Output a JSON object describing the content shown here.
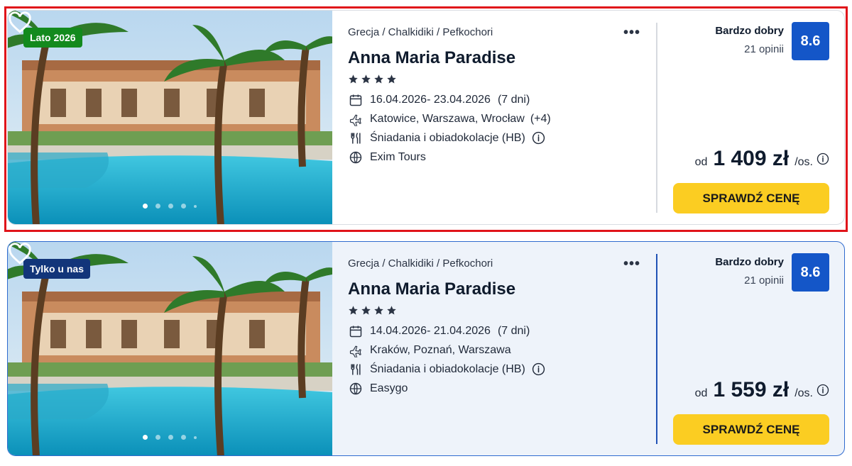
{
  "offers": [
    {
      "badge": "Lato 2026",
      "badge_color": "#138a1d",
      "breadcrumb": "Grecja / Chalkidiki / Pefkochori",
      "hotel_name": "Anna Maria Paradise",
      "stars": 4,
      "dates": "16.04.2026- 23.04.2026",
      "nights": "(7 dni)",
      "departures": "Katowice, Warszawa, Wrocław",
      "departures_extra": "(+4)",
      "board": "Śniadania i obiadokolacje (HB)",
      "operator": "Exim Tours",
      "rating_label": "Bardzo dobry",
      "rating_count": "21 opinii",
      "score": "8.6",
      "price_from": "od",
      "price": "1 409 zł",
      "price_unit": "/os.",
      "cta_label": "SPRAWDŹ CENĘ",
      "highlighted": true
    },
    {
      "badge": "Tylko u nas",
      "badge_color": "#12357a",
      "breadcrumb": "Grecja / Chalkidiki / Pefkochori",
      "hotel_name": "Anna Maria Paradise",
      "stars": 4,
      "dates": "14.04.2026- 21.04.2026",
      "nights": "(7 dni)",
      "departures": "Kraków, Poznań, Warszawa",
      "departures_extra": "",
      "board": "Śniadania i obiadokolacje (HB)",
      "operator": "Easygo",
      "rating_label": "Bardzo dobry",
      "rating_count": "21 opinii",
      "score": "8.6",
      "price_from": "od",
      "price": "1 559 zł",
      "price_unit": "/os.",
      "cta_label": "SPRAWDŹ CENĘ",
      "highlighted": false
    }
  ],
  "colors": {
    "cta": "#fbcd22",
    "score_bg": "#1456c8",
    "highlight_border": "#e0141a"
  },
  "icons": {
    "favorite": "heart-icon",
    "more": "more-dots-icon",
    "date": "calendar-icon",
    "flight": "plane-icon",
    "board": "cutlery-icon",
    "operator": "globe-icon",
    "info": "info-icon"
  }
}
